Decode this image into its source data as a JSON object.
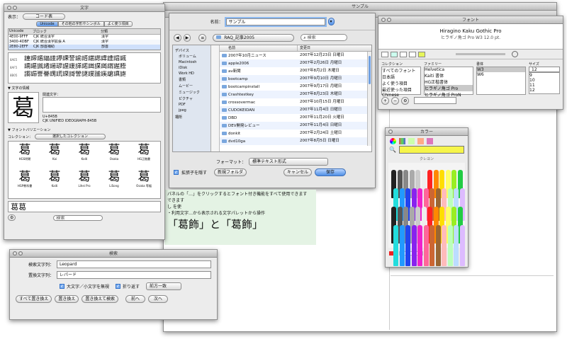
{
  "background_window": {
    "title": "サンプル"
  },
  "fonts_window": {
    "title": "フォント",
    "preview": "Hiragino Kaku Gothic Pro",
    "preview_sub": "ヒラギノ角ゴ Pro W3 12.0 pt.",
    "col_collection": "コレクション",
    "col_family": "ファミリー",
    "col_typeface": "書体",
    "col_size": "サイズ",
    "collections": [
      "すべてのフォント",
      "日本語",
      "よく使う項目",
      "最近使った項目",
      "Chinese"
    ],
    "families": [
      "Helvetica",
      "Kaiti 書体",
      "HG正楷書体",
      "ヒラギノ角ゴ Pro",
      "ヒラギノ角ゴ ProN"
    ],
    "typefaces": [
      "W3",
      "W6"
    ],
    "size_value": "12",
    "sizes": [
      "9",
      "10",
      "11",
      "12",
      "13"
    ]
  },
  "glyph_window": {
    "title": "文字",
    "filter_label": "表示：",
    "filter_value": "コード表",
    "tabs": [
      "Unicode",
      "その他の字形やシンボル",
      "よく使う項目"
    ],
    "table_header": [
      "Unicode",
      "ブロック",
      "分類"
    ],
    "table_rows": [
      [
        "4E00-9FFF",
        "CJK 統合漢字",
        "漢字"
      ],
      [
        "3400-4DBF",
        "CJK 統合漢字拡張 A",
        "漢字"
      ],
      [
        "2E80-2EFF",
        "CJK 部首補助",
        "部首"
      ]
    ],
    "grid_labels": [
      "8AE5",
      "8AF5",
      "8B05",
      "8B15"
    ],
    "grid_rows": [
      "諥諦諧諨諩諪諫諬諭諮諯諰諱諲諳諴",
      "諵諶諷諸諹諺諻諼諽諾諿謀謁謂謃謄",
      "謅謆謇謈謉謊謋謌謍謎謏謐謑謒謓謔"
    ],
    "section_info": "文字の情報",
    "big_glyph": "葛",
    "related_label": "関連文字：",
    "code_line": "U+845B",
    "code_line2": "CJK UNIFIED IDEOGRAPH-845B",
    "section_variants": "フォントバリエーション",
    "collection_label": "コレクション：",
    "collection_value": "選択したコレクション",
    "variants": [
      {
        "glyph": "葛",
        "caption": "HGS明朝"
      },
      {
        "glyph": "葛",
        "caption": "Kai"
      },
      {
        "glyph": "葛",
        "caption": "Kaiti"
      },
      {
        "glyph": "葛",
        "caption": "Osaka"
      },
      {
        "glyph": "葛",
        "caption": "HG正楷書"
      },
      {
        "glyph": "葛",
        "caption": "HGP教科書"
      },
      {
        "glyph": "葛",
        "caption": "Kaiti"
      },
      {
        "glyph": "葛",
        "caption": "Lihei Pro"
      },
      {
        "glyph": "葛",
        "caption": "LiSong"
      },
      {
        "glyph": "葛",
        "caption": "Osaka 等幅"
      }
    ],
    "bottom_glyphs": "葛葛",
    "search_placeholder": "検索"
  },
  "save_dialog": {
    "name_label": "名前：",
    "name_value": "サンプル",
    "location": "RAQ_記事2005",
    "search_placeholder": "検索",
    "sidebar_head": "デバイス",
    "sidebar_items": [
      "ボリューム",
      "Macintosh",
      "iDisk",
      "Work HD",
      "書類",
      "ムービー",
      "ミュージック",
      "ピクチャ",
      "PDF",
      "jpeg"
    ],
    "sidebar_head2": "場所",
    "files_header": [
      "名前",
      "変更日"
    ],
    "files": [
      [
        "2007年10月ニュース",
        "2007年12月23日 日曜日"
      ],
      [
        "apple2006",
        "2007年2月26日 月曜日"
      ],
      [
        "av新聞",
        "2007年8月2日 木曜日"
      ],
      [
        "bootcamp",
        "2007年9月10日 月曜日"
      ],
      [
        "bootcampinstall",
        "2007年9月17日 月曜日"
      ],
      [
        "Crashtestkey",
        "2007年8月23日 木曜日"
      ],
      [
        "crossovermac",
        "2007年10月15日 月曜日"
      ],
      [
        "CUDOKEIDAN",
        "2007年11月4日 日曜日"
      ],
      [
        "DBD",
        "2007年11月20日 火曜日"
      ],
      [
        "DEV開発レビュー",
        "2007年11月4日 日曜日"
      ],
      [
        "donkit",
        "2007年2月24日 土曜日"
      ],
      [
        "dvd10ga",
        "2007年8月5日 日曜日"
      ]
    ],
    "format_label": "フォーマット：",
    "format_value": "標準テキスト形式",
    "hide_ext_label": "拡張子を隠す",
    "new_folder": "新規フォルダ",
    "cancel": "キャンセル",
    "save": "保存"
  },
  "editor_text": {
    "lines": [
      "パネルの「…」をクリックするとフォント付き機能をすべて使用できます",
      "できます",
      "し を使",
      "・利用文字…から表示される文字パレットから操作"
    ],
    "big_line": "「葛飾」と「葛飾」"
  },
  "colors_window": {
    "title": "カラー",
    "selected_color": "#f6f54a",
    "box_label": "クレヨン"
  },
  "find_dialog": {
    "title": "検索",
    "find_label": "検索文字列：",
    "find_value": "Leopard",
    "replace_label": "置換文字列：",
    "replace_value": "レパード",
    "ignore_case": "大文字／小文字を無視",
    "wrap": "折り返す",
    "mode_value": "前方一致",
    "buttons": [
      "すべて置き換え",
      "置き換え",
      "置き換えて検索",
      "前へ",
      "次へ"
    ]
  }
}
